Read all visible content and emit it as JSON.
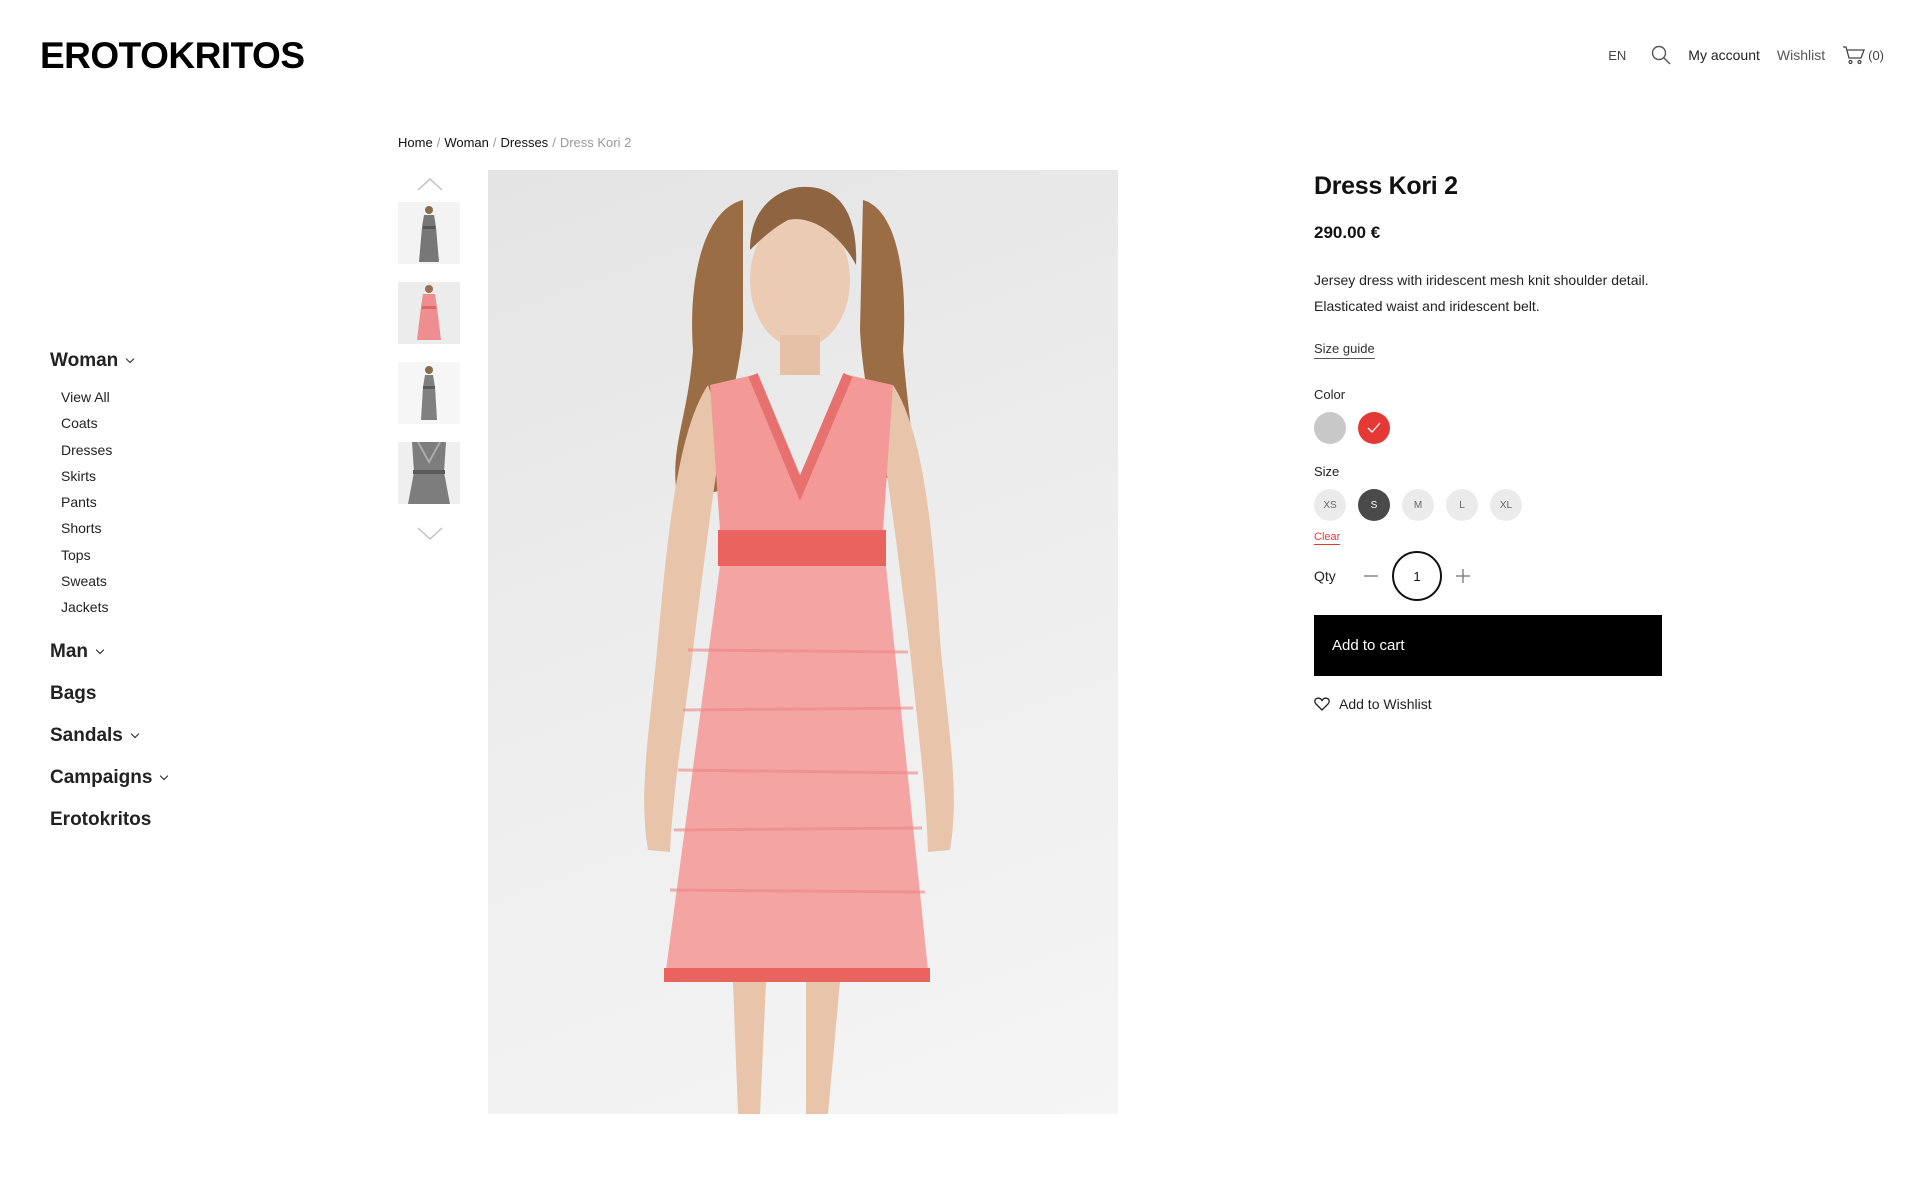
{
  "brand": {
    "logo": "EROTOKRITOS"
  },
  "topnav": {
    "lang": "EN",
    "my_account": "My account",
    "wishlist": "Wishlist",
    "cart_count": "(0)"
  },
  "sidebar": {
    "woman": {
      "label": "Woman",
      "items": [
        "View All",
        "Coats",
        "Dresses",
        "Skirts",
        "Pants",
        "Shorts",
        "Tops",
        "Sweats",
        "Jackets"
      ]
    },
    "man": "Man",
    "bags": "Bags",
    "sandals": "Sandals",
    "campaigns": "Campaigns",
    "erotokritos": "Erotokritos"
  },
  "breadcrumb": {
    "home": "Home",
    "woman": "Woman",
    "dresses": "Dresses",
    "current": "Dress Kori 2",
    "sep": "/"
  },
  "product": {
    "title": "Dress Kori 2",
    "price": "290.00 €",
    "description": "Jersey dress with iridescent mesh knit shoulder detail. Elasticated waist and iridescent belt.",
    "size_guide": "Size guide",
    "color_label": "Color",
    "colors": [
      {
        "name": "grey",
        "hex": "#c8c8c8",
        "selected": false
      },
      {
        "name": "red",
        "hex": "#e53935",
        "selected": true
      }
    ],
    "size_label": "Size",
    "sizes": [
      {
        "label": "XS",
        "selected": false
      },
      {
        "label": "S",
        "selected": true
      },
      {
        "label": "M",
        "selected": false
      },
      {
        "label": "L",
        "selected": false
      },
      {
        "label": "XL",
        "selected": false
      }
    ],
    "clear": "Clear",
    "qty_label": "Qty",
    "qty_value": "1",
    "add_to_cart": "Add to cart",
    "add_to_wishlist": "Add to Wishlist"
  },
  "colors": {
    "accent_red": "#e53935",
    "dress_pink": "#f08a8a",
    "button_black": "#000000"
  }
}
